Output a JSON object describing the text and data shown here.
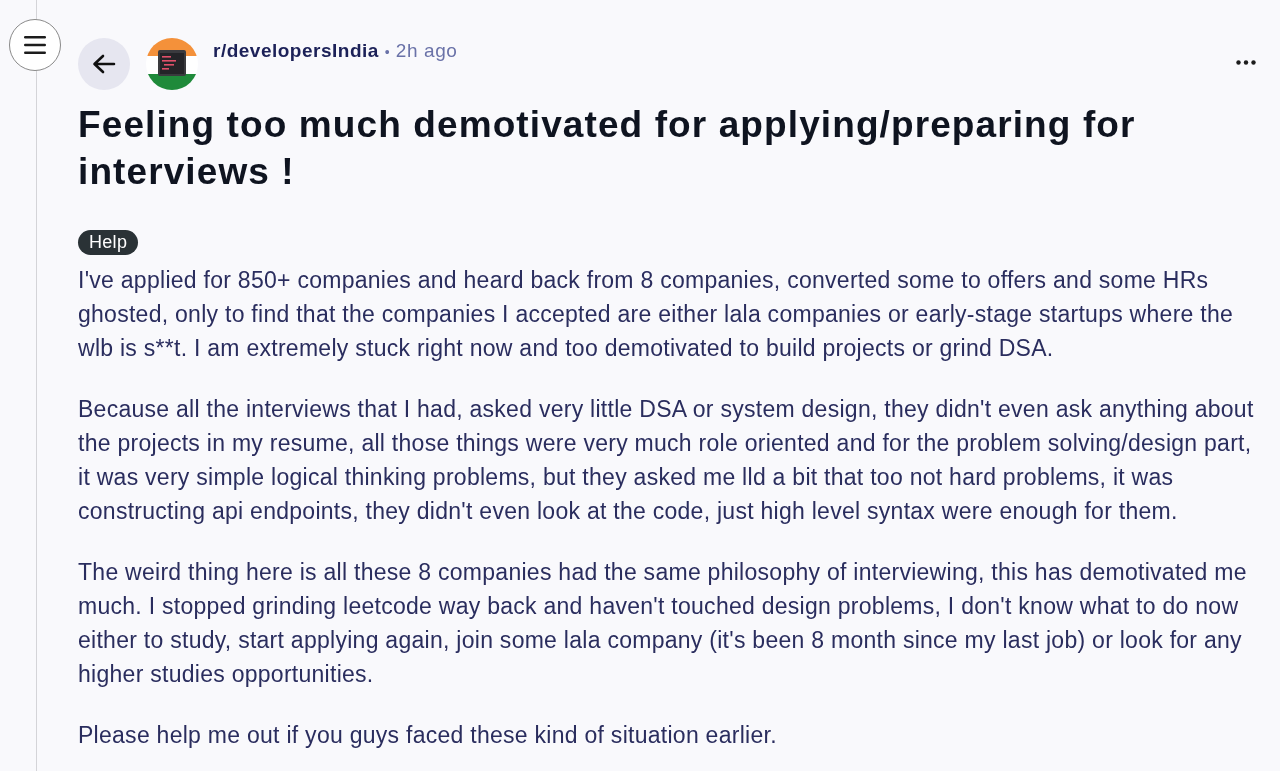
{
  "post": {
    "subreddit": "r/developersIndia",
    "separator": "•",
    "time": "2h ago",
    "title": "Feeling too much demotivated for applying/preparing for interviews !",
    "flair": "Help",
    "paragraphs": [
      "I've applied for 850+ companies and heard back from 8 companies, converted some to offers and some HRs ghosted, only to find that the companies I accepted are either lala companies or early-stage startups where the wlb is s**t. I am extremely stuck right now and too demotivated to build projects or grind DSA.",
      "Because all the interviews that I had, asked very little DSA or system design, they didn't even ask anything about the projects in my resume, all those things were very much role oriented and for the problem solving/design part, it was very simple logical thinking problems, but they asked me lld a bit that too not hard problems, it was constructing api endpoints, they didn't even look at the code, just high level syntax were enough for them.",
      "The weird thing here is all these 8 companies had the same philosophy of interviewing, this has demotivated me much. I stopped grinding leetcode way back and haven't touched design problems, I don't know what to do now either to study, start applying again, join some lala company (it's been 8 month since my last job) or look for any higher studies opportunities.",
      "Please help me out if you guys faced these kind of situation earlier."
    ]
  }
}
